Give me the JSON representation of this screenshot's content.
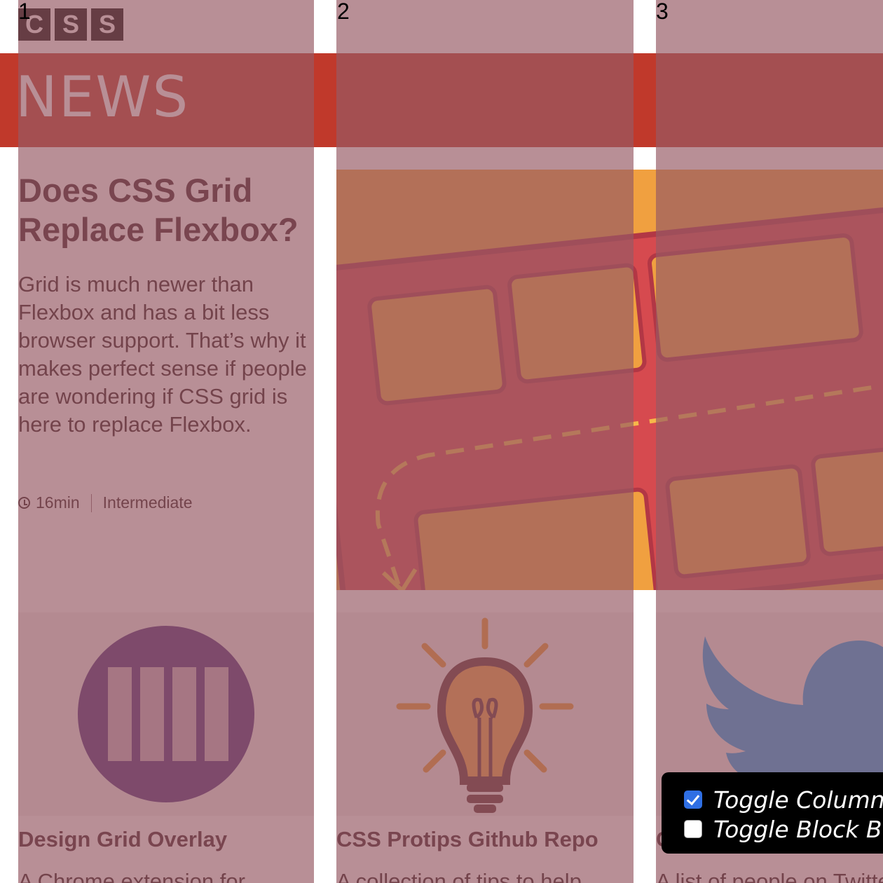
{
  "header": {
    "logo_letters": [
      "C",
      "S",
      "S"
    ],
    "section_title": "NEWS",
    "bar_color": "#c0392b"
  },
  "grid_overlay": {
    "column_numbers": [
      "1",
      "2",
      "3"
    ],
    "overlay_color": "#965a64"
  },
  "article": {
    "title": "Does CSS Grid Replace Flexbox?",
    "excerpt": "Grid is much newer than Flexbox and has a bit less browser support. That’s why it makes perfect sense if people are wondering if CSS grid is here to replace Flexbox.",
    "read_time": "16min",
    "level": "Intermediate",
    "clock_icon": "clock-icon",
    "hero_icon": "grid-flow-illustration"
  },
  "cards": [
    {
      "title": "Design Grid Overlay",
      "desc": "A Chrome extension for",
      "icon": "columns-circle-icon"
    },
    {
      "title": "CSS Protips Github Repo",
      "desc": "A collection of tips to help",
      "icon": "lightbulb-icon"
    },
    {
      "title": "C",
      "desc": "A list of people on Twitter",
      "icon": "twitter-bird-icon"
    }
  ],
  "toggles": [
    {
      "label": "Toggle Column Overlay",
      "checked": true
    },
    {
      "label": "Toggle Block Borders",
      "checked": false
    }
  ],
  "colors": {
    "accent": "#c0392b",
    "hero_bg": "#f0a040",
    "checkbox_on": "#2f6fe4",
    "twitter": "#1da1f2",
    "circle_icon": "#4b2a7a"
  }
}
